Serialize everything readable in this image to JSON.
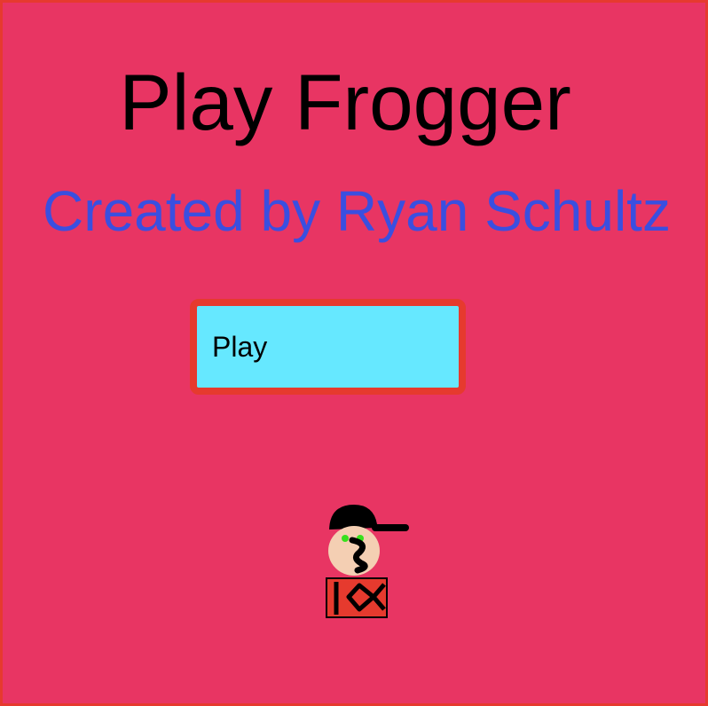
{
  "title": "Play Frogger",
  "subtitle": "Created by Ryan Schultz",
  "play_button": {
    "label": "Play"
  },
  "colors": {
    "background": "#e83563",
    "border": "#e63a2e",
    "subtitle": "#3a4fe0",
    "button_fill": "#66e8ff"
  },
  "icons": {
    "character": "player-character-icon"
  }
}
